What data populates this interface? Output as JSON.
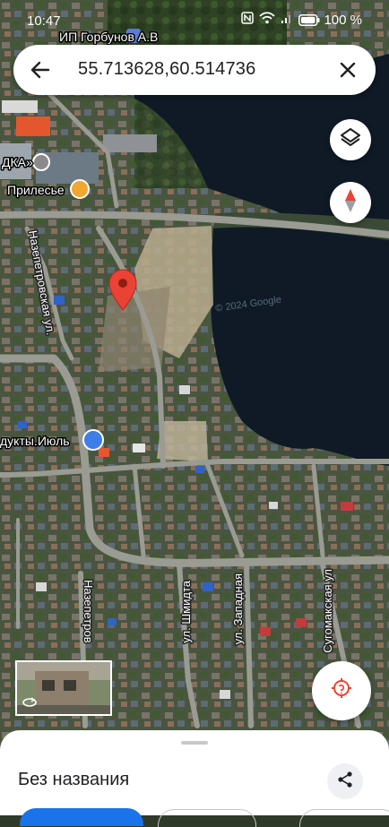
{
  "status_bar": {
    "time": "10:47",
    "battery": "100 %"
  },
  "search": {
    "query": "55.713628,60.514736"
  },
  "map": {
    "poi_labels": [
      "ИП Горбунов А.В",
      "ДКА»",
      "Прилесье",
      "дукты.Июль"
    ],
    "street_labels": [
      "Назепетровская ул.",
      "Назепетров",
      "ул. Шмидта",
      "ул. Западная",
      "Сугомакская ул"
    ],
    "watermark": "© 2024 Google"
  },
  "bottom_sheet": {
    "title": "Без названия"
  },
  "colors": {
    "pin": "#ea4335",
    "accent": "#1a73e8",
    "water": "#0f1a26"
  }
}
